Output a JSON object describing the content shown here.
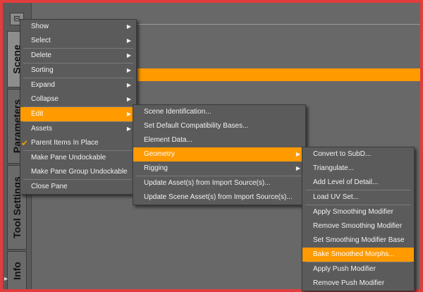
{
  "sidebar": {
    "pane_button": "⊟",
    "tabs": [
      "Scene",
      "Parameters",
      "Tool Settings",
      "Info"
    ],
    "bottom_arrow": "▸"
  },
  "menu_main": {
    "items": [
      "Show",
      "Select",
      "Delete",
      "Sorting",
      "Expand",
      "Collapse",
      "Edit",
      "Assets",
      "Parent Items In Place",
      "Make Pane Undockable",
      "Make Pane Group Undockable",
      "Close Pane"
    ],
    "checked_item": "Parent Items In Place",
    "highlighted_item": "Edit"
  },
  "menu_edit": {
    "items": [
      "Scene Identification...",
      "Set Default Compatibility Bases...",
      "Element Data...",
      "Geometry",
      "Rigging",
      "Update Asset(s) from Import Source(s)...",
      "Update Scene Asset(s) from Import Source(s)..."
    ],
    "highlighted_item": "Geometry"
  },
  "menu_geometry": {
    "items": [
      "Convert to SubD...",
      "Triangulate...",
      "Add Level of Detail...",
      "Load UV Set...",
      "Apply Smoothing Modifier",
      "Remove Smoothing Modifier",
      "Set Smoothing Modifier Base",
      "Bake Smoothed Morphs...",
      "Apply Push Modifier",
      "Remove Push Modifier"
    ],
    "highlighted_item": "Bake Smoothed Morphs..."
  },
  "glyphs": {
    "submenu_arrow": "▶",
    "check": "✔"
  },
  "colors": {
    "frame": "#e23c3c",
    "highlight": "#ff9a00",
    "menu_bg": "#5b5b5b"
  }
}
